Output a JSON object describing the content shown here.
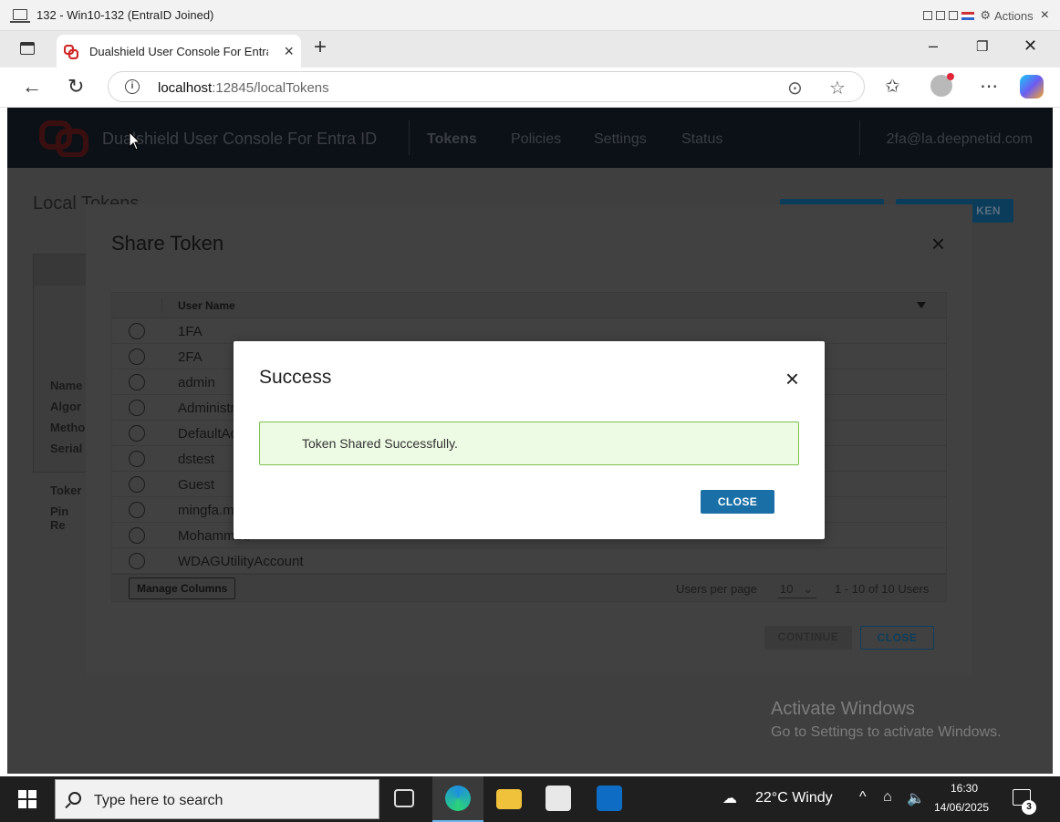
{
  "vm": {
    "title": "132 - Win10-132 (EntraID Joined)",
    "actions_label": "Actions",
    "close_glyph": "×"
  },
  "browser": {
    "tab_title": "Dualshield User Console For Entra ID",
    "tab_close_glyph": "×",
    "new_tab_glyph": "+",
    "url_host": "localhost",
    "url_rest": ":12845/localTokens",
    "minimize_glyph": "–",
    "restore_glyph": "❐",
    "close_glyph": "✕"
  },
  "app": {
    "brand": "Dualshield User Console For Entra ID",
    "nav": [
      "Tokens",
      "Policies",
      "Settings",
      "Status"
    ],
    "user": "2fa@la.deepnetid.com",
    "page_title": "Local Tokens",
    "header_button_2_partial": "KEN",
    "card_labels": [
      "Name",
      "Algor",
      "Metho",
      "Serial",
      "Toker",
      "Pin Re"
    ]
  },
  "share_modal": {
    "title": "Share Token",
    "close_glyph": "×",
    "column_header": "User Name",
    "users": [
      "1FA",
      "2FA",
      "admin",
      "Administrator",
      "DefaultAccount",
      "dstest",
      "Guest",
      "mingfa.m",
      "Mohammed",
      "WDAGUtilityAccount"
    ],
    "manage_columns": "Manage Columns",
    "users_per_page_label": "Users per page",
    "users_per_page": "10",
    "range_text": "1 - 10 of 10 Users",
    "continue_label": "CONTINUE",
    "close_label": "CLOSE"
  },
  "success_dialog": {
    "title": "Success",
    "close_glyph": "×",
    "message": "Token Shared Successfully.",
    "close_button": "CLOSE"
  },
  "watermark": {
    "line1": "Activate Windows",
    "line2": "Go to Settings to activate Windows."
  },
  "taskbar": {
    "search_placeholder": "Type here to search",
    "weather": "22°C  Windy",
    "time": "16:30",
    "date": "14/06/2025",
    "notifications_count": "3"
  },
  "colors": {
    "primary_button": "#1a6fa6",
    "success_bg": "#eefbe4",
    "success_border": "#7cc04a",
    "app_header": "#0c1117"
  }
}
